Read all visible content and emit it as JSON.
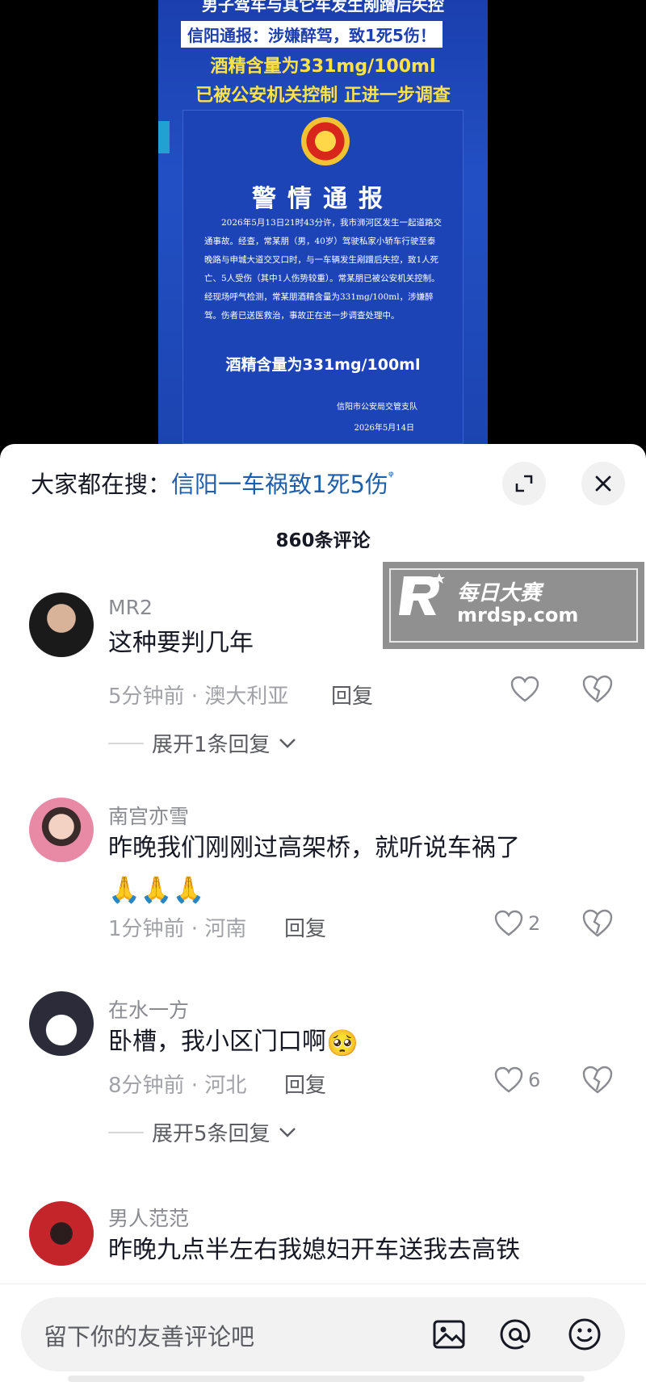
{
  "video": {
    "line1": "男子驾车与其它车发生剐蹭后失控",
    "line2": "信阳通报：涉嫌醉驾，致1死5伤！",
    "line3": "酒精含量为331mg/100ml",
    "line4": "已被公安机关控制 正进一步调查",
    "notice_title": "警情通报",
    "notice_body": "2026年5月13日21时43分许，我市浉河区发生一起道路交通事故。经查，常某朋（男，40岁）驾驶私家小轿车行驶至泰晚路与申城大道交叉口时，与一车辆发生剐蹭后失控，致1人死亡、5人受伤（其中1人伤势较重）。常某朋已被公安机关控制。经现场呼气检测，常某朋酒精含量为331mg/100ml，涉嫌醉驾。伤者已送医救治，事故正在进一步调查处理中。",
    "notice_big": "酒精含量为331mg/100ml",
    "notice_dept": "信阳市公安局交管支队",
    "notice_date": "2026年5月14日"
  },
  "panel": {
    "search_prefix": "大家都在搜：",
    "search_term": "信阳一车祸致1死5伤",
    "search_glyph": "ᵠ",
    "comment_count": "860条评论"
  },
  "comments": [
    {
      "name": "MR2",
      "text": "这种要判几年",
      "meta": "5分钟前 · 澳大利亚",
      "reply": "回复",
      "likes": "",
      "expand": "展开1条回复"
    },
    {
      "name": "南宫亦雪",
      "text": "昨晚我们刚刚过高架桥，就听说车祸了",
      "emojis": "🙏🙏🙏",
      "meta": "1分钟前 · 河南",
      "reply": "回复",
      "likes": "2"
    },
    {
      "name": "在水一方",
      "text": "卧槽，我小区门口啊",
      "emojis": "🥺",
      "meta": "8分钟前 · 河北",
      "reply": "回复",
      "likes": "6",
      "expand": "展开5条回复"
    },
    {
      "name": "男人范范",
      "text": "昨晚九点半左右我媳妇开车送我去高铁"
    }
  ],
  "watermark": {
    "title": "每日大赛",
    "url": "mrdsp.com"
  },
  "input": {
    "placeholder": "留下你的友善评论吧"
  },
  "icons": [
    "expand-icon",
    "close-icon",
    "heart-icon",
    "dislike-icon",
    "chevron-down-icon",
    "image-icon",
    "at-icon",
    "emoji-icon"
  ]
}
